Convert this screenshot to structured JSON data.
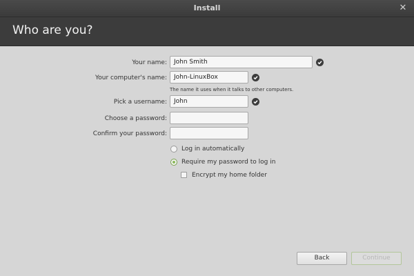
{
  "window": {
    "title": "Install",
    "close_glyph": "✕"
  },
  "header": {
    "title": "Who are you?"
  },
  "form": {
    "name": {
      "label": "Your name:",
      "value": "John Smith",
      "valid_icon": "check-circle-icon"
    },
    "computer": {
      "label": "Your computer's name:",
      "value": "John-LinuxBox",
      "hint": "The name it uses when it talks to other computers.",
      "valid_icon": "check-circle-icon"
    },
    "username": {
      "label": "Pick a username:",
      "value": "John",
      "valid_icon": "check-circle-icon"
    },
    "password": {
      "label": "Choose a password:",
      "value": ""
    },
    "confirm": {
      "label": "Confirm your password:",
      "value": ""
    },
    "options": {
      "auto_login": {
        "label": "Log in automatically",
        "selected": false
      },
      "require_password": {
        "label": "Require my password to log in",
        "selected": true
      },
      "encrypt_home": {
        "label": "Encrypt my home folder",
        "checked": false
      }
    }
  },
  "buttons": {
    "back": "Back",
    "continue": "Continue",
    "continue_enabled": false
  },
  "colors": {
    "header_bg": "#3c3c3c",
    "body_bg": "#d6d6d6",
    "accent": "#8cba5b"
  }
}
